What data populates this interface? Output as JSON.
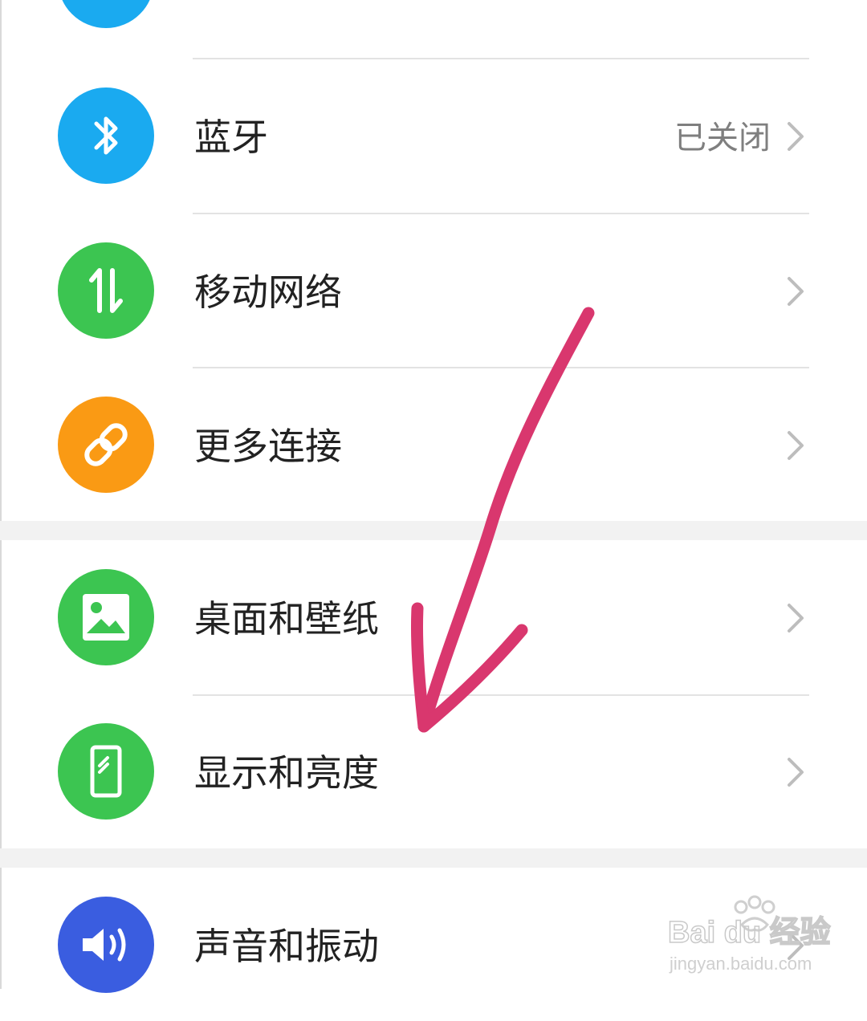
{
  "settings": {
    "items": [
      {
        "label": "",
        "icon": "partial-icon",
        "color": "#1aaaf0"
      },
      {
        "label": "蓝牙",
        "status": "已关闭",
        "icon": "bluetooth-icon",
        "color": "#1aaaf0"
      },
      {
        "label": "移动网络",
        "icon": "mobile-data-icon",
        "color": "#3cc551"
      },
      {
        "label": "更多连接",
        "icon": "link-icon",
        "color": "#fa9a14"
      },
      {
        "label": "桌面和壁纸",
        "icon": "image-icon",
        "color": "#3cc551"
      },
      {
        "label": "显示和亮度",
        "icon": "phone-display-icon",
        "color": "#3cc551"
      },
      {
        "label": "声音和振动",
        "icon": "speaker-icon",
        "color": "#3a5de0"
      }
    ]
  },
  "annotation": {
    "color": "#d9376e"
  },
  "watermark": {
    "brand": "Bai du 经验",
    "url": "jingyan.baidu.com"
  }
}
